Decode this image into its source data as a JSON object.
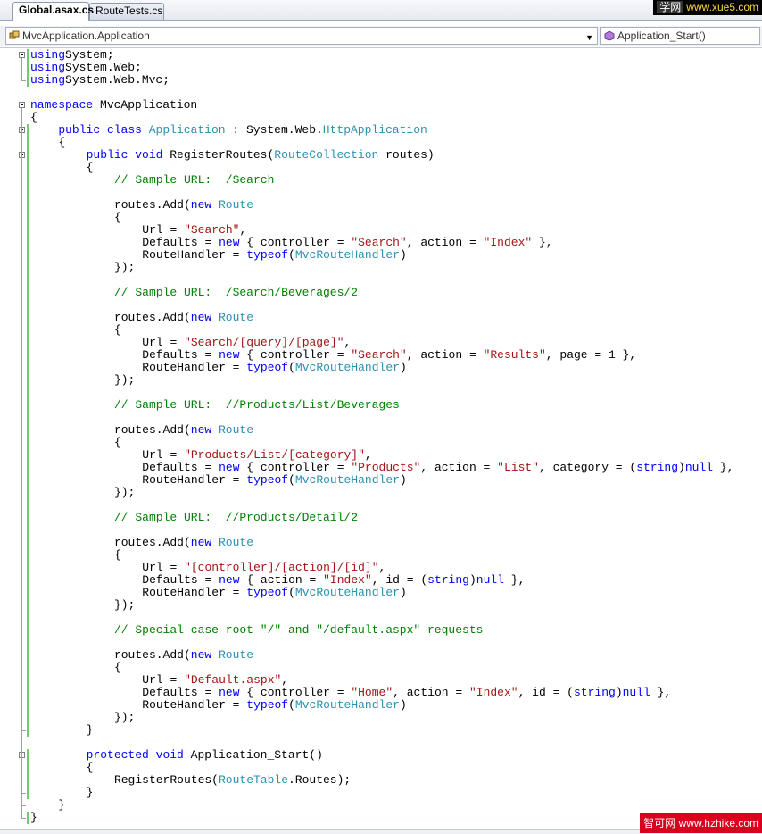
{
  "tabs": [
    {
      "label": "Global.asax.cs",
      "active": true
    },
    {
      "label": "RouteTests.cs",
      "active": false
    }
  ],
  "watermark_top": {
    "cn": "学网",
    "url": "www.xue5.com"
  },
  "watermark_bottom": "智可网 www.hzhike.com",
  "navbar": {
    "class_combo": "MvcApplication.Application",
    "member_combo": "Application_Start()"
  },
  "colors": {
    "keyword": "#0000ff",
    "type": "#2b91af",
    "string": "#a31515",
    "comment": "#008000",
    "change_marker": "#6ece6e"
  },
  "code_lines": [
    {
      "row": 0,
      "indent": 0,
      "tokens": [
        [
          "kw",
          "using"
        ],
        [
          "",
          "System;"
        ]
      ]
    },
    {
      "row": 1,
      "indent": 0,
      "tokens": [
        [
          "kw",
          "using"
        ],
        [
          "",
          "System.Web;"
        ]
      ]
    },
    {
      "row": 2,
      "indent": 0,
      "tokens": [
        [
          "kw",
          "using"
        ],
        [
          "",
          "System.Web.Mvc;"
        ]
      ]
    },
    {
      "row": 4,
      "indent": 0,
      "tokens": [
        [
          "kw",
          "namespace"
        ],
        [
          "",
          " MvcApplication"
        ]
      ]
    },
    {
      "row": 5,
      "indent": 0,
      "tokens": [
        [
          "",
          "{"
        ]
      ]
    },
    {
      "row": 6,
      "indent": 4,
      "tokens": [
        [
          "kw",
          "public class"
        ],
        [
          "",
          " "
        ],
        [
          "ty",
          "Application"
        ],
        [
          "",
          " : System.Web."
        ],
        [
          "ty",
          "HttpApplication"
        ]
      ]
    },
    {
      "row": 7,
      "indent": 4,
      "tokens": [
        [
          "",
          "{"
        ]
      ]
    },
    {
      "row": 8,
      "indent": 8,
      "tokens": [
        [
          "kw",
          "public void"
        ],
        [
          "",
          " RegisterRoutes("
        ],
        [
          "ty",
          "RouteCollection"
        ],
        [
          "",
          " routes)"
        ]
      ]
    },
    {
      "row": 9,
      "indent": 8,
      "tokens": [
        [
          "",
          "{"
        ]
      ]
    },
    {
      "row": 10,
      "indent": 12,
      "tokens": [
        [
          "cm",
          "// Sample URL:  /Search"
        ]
      ]
    },
    {
      "row": 12,
      "indent": 12,
      "tokens": [
        [
          "",
          "routes.Add("
        ],
        [
          "kw",
          "new"
        ],
        [
          "",
          " "
        ],
        [
          "ty",
          "Route"
        ]
      ]
    },
    {
      "row": 13,
      "indent": 12,
      "tokens": [
        [
          "",
          "{"
        ]
      ]
    },
    {
      "row": 14,
      "indent": 16,
      "tokens": [
        [
          "",
          "Url = "
        ],
        [
          "st",
          "\"Search\""
        ],
        [
          "",
          ","
        ]
      ]
    },
    {
      "row": 15,
      "indent": 16,
      "tokens": [
        [
          "",
          "Defaults = "
        ],
        [
          "kw",
          "new"
        ],
        [
          "",
          " { controller = "
        ],
        [
          "st",
          "\"Search\""
        ],
        [
          "",
          ", action = "
        ],
        [
          "st",
          "\"Index\""
        ],
        [
          "",
          " },"
        ]
      ]
    },
    {
      "row": 16,
      "indent": 16,
      "tokens": [
        [
          "",
          "RouteHandler = "
        ],
        [
          "kw",
          "typeof"
        ],
        [
          "",
          "("
        ],
        [
          "ty",
          "MvcRouteHandler"
        ],
        [
          "",
          ")"
        ]
      ]
    },
    {
      "row": 17,
      "indent": 12,
      "tokens": [
        [
          "",
          "});"
        ]
      ]
    },
    {
      "row": 19,
      "indent": 12,
      "tokens": [
        [
          "cm",
          "// Sample URL:  /Search/Beverages/2"
        ]
      ]
    },
    {
      "row": 21,
      "indent": 12,
      "tokens": [
        [
          "",
          "routes.Add("
        ],
        [
          "kw",
          "new"
        ],
        [
          "",
          " "
        ],
        [
          "ty",
          "Route"
        ]
      ]
    },
    {
      "row": 22,
      "indent": 12,
      "tokens": [
        [
          "",
          "{"
        ]
      ]
    },
    {
      "row": 23,
      "indent": 16,
      "tokens": [
        [
          "",
          "Url = "
        ],
        [
          "st",
          "\"Search/[query]/[page]\""
        ],
        [
          "",
          ","
        ]
      ]
    },
    {
      "row": 24,
      "indent": 16,
      "tokens": [
        [
          "",
          "Defaults = "
        ],
        [
          "kw",
          "new"
        ],
        [
          "",
          " { controller = "
        ],
        [
          "st",
          "\"Search\""
        ],
        [
          "",
          ", action = "
        ],
        [
          "st",
          "\"Results\""
        ],
        [
          "",
          ", page = 1 },"
        ]
      ]
    },
    {
      "row": 25,
      "indent": 16,
      "tokens": [
        [
          "",
          "RouteHandler = "
        ],
        [
          "kw",
          "typeof"
        ],
        [
          "",
          "("
        ],
        [
          "ty",
          "MvcRouteHandler"
        ],
        [
          "",
          ")"
        ]
      ]
    },
    {
      "row": 26,
      "indent": 12,
      "tokens": [
        [
          "",
          "});"
        ]
      ]
    },
    {
      "row": 28,
      "indent": 12,
      "tokens": [
        [
          "cm",
          "// Sample URL:  //Products/List/Beverages"
        ]
      ]
    },
    {
      "row": 30,
      "indent": 12,
      "tokens": [
        [
          "",
          "routes.Add("
        ],
        [
          "kw",
          "new"
        ],
        [
          "",
          " "
        ],
        [
          "ty",
          "Route"
        ]
      ]
    },
    {
      "row": 31,
      "indent": 12,
      "tokens": [
        [
          "",
          "{"
        ]
      ]
    },
    {
      "row": 32,
      "indent": 16,
      "tokens": [
        [
          "",
          "Url = "
        ],
        [
          "st",
          "\"Products/List/[category]\""
        ],
        [
          "",
          ","
        ]
      ]
    },
    {
      "row": 33,
      "indent": 16,
      "tokens": [
        [
          "",
          "Defaults = "
        ],
        [
          "kw",
          "new"
        ],
        [
          "",
          " { controller = "
        ],
        [
          "st",
          "\"Products\""
        ],
        [
          "",
          ", action = "
        ],
        [
          "st",
          "\"List\""
        ],
        [
          "",
          ", category = ("
        ],
        [
          "kw",
          "string"
        ],
        [
          "",
          ")"
        ],
        [
          "kw",
          "null"
        ],
        [
          "",
          " },"
        ]
      ]
    },
    {
      "row": 34,
      "indent": 16,
      "tokens": [
        [
          "",
          "RouteHandler = "
        ],
        [
          "kw",
          "typeof"
        ],
        [
          "",
          "("
        ],
        [
          "ty",
          "MvcRouteHandler"
        ],
        [
          "",
          ")"
        ]
      ]
    },
    {
      "row": 35,
      "indent": 12,
      "tokens": [
        [
          "",
          "});"
        ]
      ]
    },
    {
      "row": 37,
      "indent": 12,
      "tokens": [
        [
          "cm",
          "// Sample URL:  //Products/Detail/2"
        ]
      ]
    },
    {
      "row": 39,
      "indent": 12,
      "tokens": [
        [
          "",
          "routes.Add("
        ],
        [
          "kw",
          "new"
        ],
        [
          "",
          " "
        ],
        [
          "ty",
          "Route"
        ]
      ]
    },
    {
      "row": 40,
      "indent": 12,
      "tokens": [
        [
          "",
          "{"
        ]
      ]
    },
    {
      "row": 41,
      "indent": 16,
      "tokens": [
        [
          "",
          "Url = "
        ],
        [
          "st",
          "\"[controller]/[action]/[id]\""
        ],
        [
          "",
          ","
        ]
      ]
    },
    {
      "row": 42,
      "indent": 16,
      "tokens": [
        [
          "",
          "Defaults = "
        ],
        [
          "kw",
          "new"
        ],
        [
          "",
          " { action = "
        ],
        [
          "st",
          "\"Index\""
        ],
        [
          "",
          ", id = ("
        ],
        [
          "kw",
          "string"
        ],
        [
          "",
          ")"
        ],
        [
          "kw",
          "null"
        ],
        [
          "",
          " },"
        ]
      ]
    },
    {
      "row": 43,
      "indent": 16,
      "tokens": [
        [
          "",
          "RouteHandler = "
        ],
        [
          "kw",
          "typeof"
        ],
        [
          "",
          "("
        ],
        [
          "ty",
          "MvcRouteHandler"
        ],
        [
          "",
          ")"
        ]
      ]
    },
    {
      "row": 44,
      "indent": 12,
      "tokens": [
        [
          "",
          "});"
        ]
      ]
    },
    {
      "row": 46,
      "indent": 12,
      "tokens": [
        [
          "cm",
          "// Special-case root \"/\" and \"/default.aspx\" requests"
        ]
      ]
    },
    {
      "row": 48,
      "indent": 12,
      "tokens": [
        [
          "",
          "routes.Add("
        ],
        [
          "kw",
          "new"
        ],
        [
          "",
          " "
        ],
        [
          "ty",
          "Route"
        ]
      ]
    },
    {
      "row": 49,
      "indent": 12,
      "tokens": [
        [
          "",
          "{"
        ]
      ]
    },
    {
      "row": 50,
      "indent": 16,
      "tokens": [
        [
          "",
          "Url = "
        ],
        [
          "st",
          "\"Default.aspx\""
        ],
        [
          "",
          ","
        ]
      ]
    },
    {
      "row": 51,
      "indent": 16,
      "tokens": [
        [
          "",
          "Defaults = "
        ],
        [
          "kw",
          "new"
        ],
        [
          "",
          " { controller = "
        ],
        [
          "st",
          "\"Home\""
        ],
        [
          "",
          ", action = "
        ],
        [
          "st",
          "\"Index\""
        ],
        [
          "",
          ", id = ("
        ],
        [
          "kw",
          "string"
        ],
        [
          "",
          ")"
        ],
        [
          "kw",
          "null"
        ],
        [
          "",
          " },"
        ]
      ]
    },
    {
      "row": 52,
      "indent": 16,
      "tokens": [
        [
          "",
          "RouteHandler = "
        ],
        [
          "kw",
          "typeof"
        ],
        [
          "",
          "("
        ],
        [
          "ty",
          "MvcRouteHandler"
        ],
        [
          "",
          ")"
        ]
      ]
    },
    {
      "row": 53,
      "indent": 12,
      "tokens": [
        [
          "",
          "});"
        ]
      ]
    },
    {
      "row": 54,
      "indent": 8,
      "tokens": [
        [
          "",
          "}"
        ]
      ]
    },
    {
      "row": 56,
      "indent": 8,
      "tokens": [
        [
          "kw",
          "protected void"
        ],
        [
          "",
          " Application_Start()"
        ]
      ]
    },
    {
      "row": 57,
      "indent": 8,
      "tokens": [
        [
          "",
          "{"
        ]
      ]
    },
    {
      "row": 58,
      "indent": 12,
      "tokens": [
        [
          "",
          "RegisterRoutes("
        ],
        [
          "ty",
          "RouteTable"
        ],
        [
          "",
          ".Routes);"
        ]
      ]
    },
    {
      "row": 59,
      "indent": 8,
      "tokens": [
        [
          "",
          "}"
        ]
      ]
    },
    {
      "row": 60,
      "indent": 4,
      "tokens": [
        [
          "",
          "}"
        ]
      ]
    },
    {
      "row": 61,
      "indent": 0,
      "tokens": [
        [
          "",
          "}"
        ]
      ]
    }
  ]
}
